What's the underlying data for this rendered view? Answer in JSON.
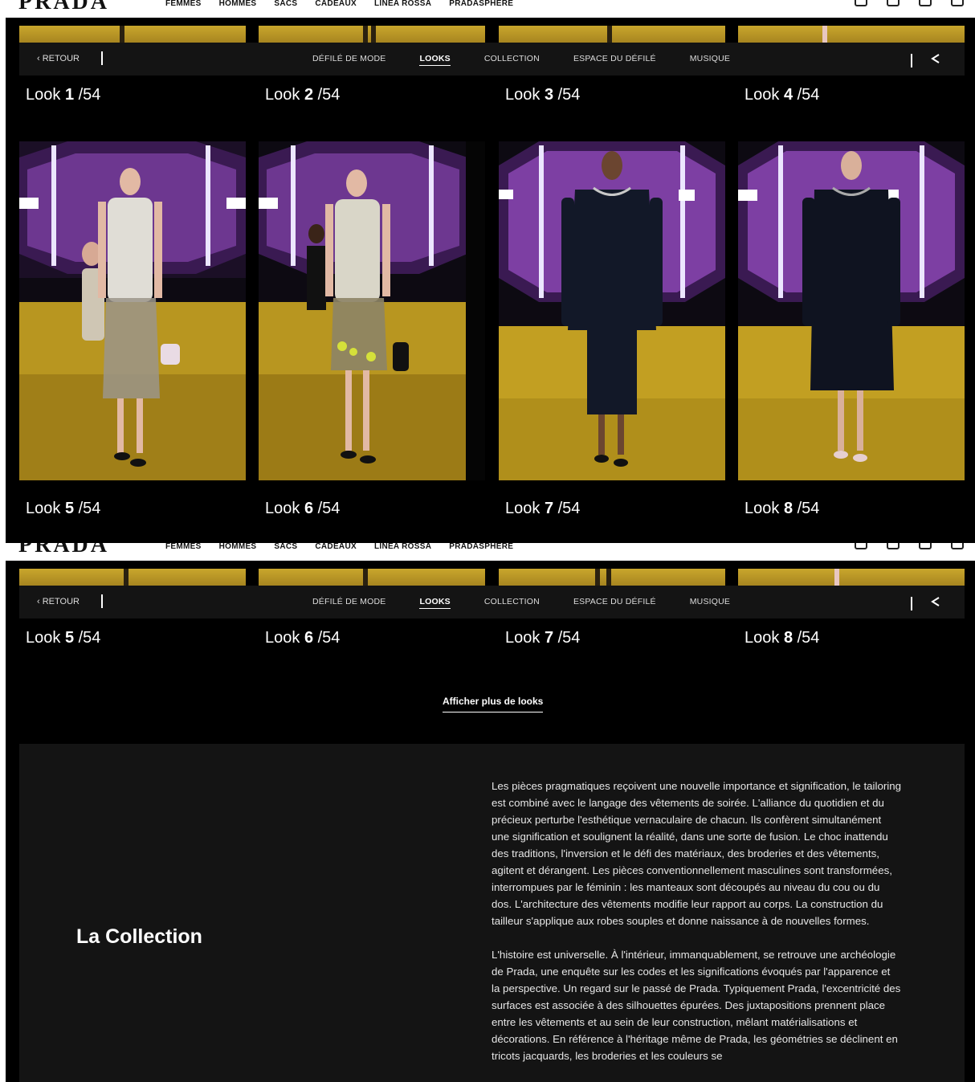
{
  "brand": {
    "logo": "PRADA"
  },
  "topnav": {
    "items": [
      "FEMMES",
      "HOMMES",
      "SACS",
      "CADEAUX",
      "LINEA ROSSA",
      "PRADASPHERE"
    ]
  },
  "subnav": {
    "back": "‹ RETOUR",
    "tabs": [
      {
        "label": "DÉFILÉ DE MODE",
        "active": false
      },
      {
        "label": "LOOKS",
        "active": true
      },
      {
        "label": "COLLECTION",
        "active": false
      },
      {
        "label": "ESPACE DU DÉFILÉ",
        "active": false
      },
      {
        "label": "MUSIQUE",
        "active": false
      }
    ]
  },
  "frame1": {
    "looks_top": [
      {
        "prefix": "Look ",
        "num": "1",
        "total": " /54"
      },
      {
        "prefix": "Look ",
        "num": "2",
        "total": " /54"
      },
      {
        "prefix": "Look ",
        "num": "3",
        "total": " /54"
      },
      {
        "prefix": "Look ",
        "num": "4",
        "total": " /54"
      }
    ],
    "looks_bottom": [
      {
        "prefix": "Look ",
        "num": "5",
        "total": " /54"
      },
      {
        "prefix": "Look ",
        "num": "6",
        "total": " /54"
      },
      {
        "prefix": "Look ",
        "num": "7",
        "total": " /54"
      },
      {
        "prefix": "Look ",
        "num": "8",
        "total": " /54"
      }
    ]
  },
  "frame2": {
    "looks_top": [
      {
        "prefix": "Look ",
        "num": "5",
        "total": " /54"
      },
      {
        "prefix": "Look ",
        "num": "6",
        "total": " /54"
      },
      {
        "prefix": "Look ",
        "num": "7",
        "total": " /54"
      },
      {
        "prefix": "Look ",
        "num": "8",
        "total": " /54"
      }
    ],
    "more_button": "Afficher plus de looks"
  },
  "collection": {
    "title": "La Collection",
    "paragraphs": [
      "Les pièces pragmatiques reçoivent une nouvelle importance et signification, le tailoring est combiné avec le langage des vêtements de soirée. L'alliance du quotidien et du précieux perturbe l'esthétique vernaculaire de chacun. Ils confèrent simultanément une signification et soulignent la réalité, dans une sorte de fusion. Le choc inattendu des traditions, l'inversion et le défi des matériaux, des broderies et des vêtements, agitent et dérangent. Les pièces conventionnellement masculines sont transformées, interrompues par le féminin : les manteaux sont découpés au niveau du cou ou du dos. L'architecture des vêtements modifie leur rapport au corps. La construction du tailleur s'applique aux robes souples et donne naissance à de nouvelles formes.",
      "L'histoire est universelle. À l'intérieur, immanquablement, se retrouve une archéologie de Prada, une enquête sur les codes et les significations évoqués par l'apparence et la perspective. Un regard sur le passé de Prada. Typiquement Prada, l'excentricité des surfaces est associée à des silhouettes épurées. Des juxtapositions prennent place entre les vêtements et au sein de leur construction, mêlant matérialisations et décorations. En référence à l'héritage même de Prada, les géométries se déclinent en tricots jacquards, les broderies et les couleurs se"
    ]
  },
  "icons": [
    "user-icon",
    "heart-icon",
    "bag-icon",
    "search-icon",
    "share-icon",
    "chevron-left-icon"
  ],
  "colors": {
    "background": "#000000",
    "panel": "#141414",
    "runway": "#c9a62c",
    "lights": "#b25ad6"
  }
}
